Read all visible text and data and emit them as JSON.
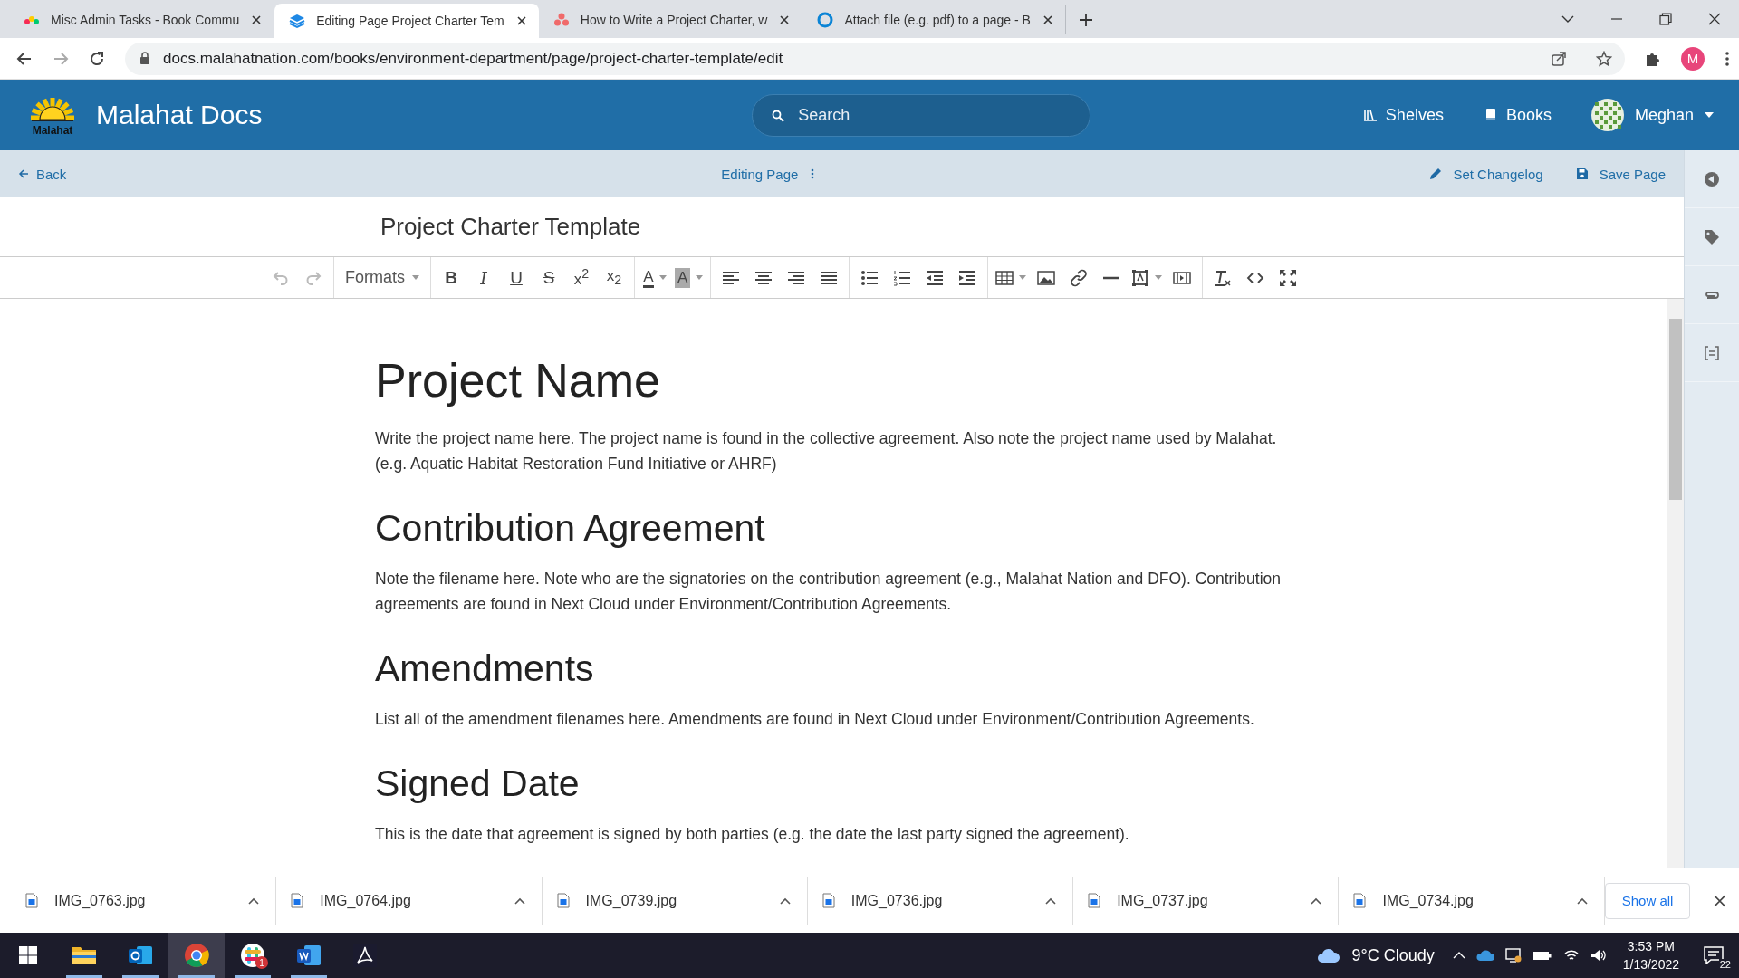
{
  "browser": {
    "tabs": [
      {
        "title": "Misc Admin Tasks - Book Commu",
        "kind": "dots",
        "selected": false
      },
      {
        "title": "Editing Page Project Charter Tem",
        "kind": "stack",
        "selected": true
      },
      {
        "title": "How to Write a Project Charter, w",
        "kind": "trio",
        "selected": false
      },
      {
        "title": "Attach file (e.g. pdf) to a page - B",
        "kind": "ring",
        "selected": false
      }
    ],
    "url": "docs.malahatnation.com/books/environment-department/page/project-charter-template/edit",
    "profile_initial": "M"
  },
  "header": {
    "logo_text": "Malahat",
    "site_name": "Malahat Docs",
    "search": {
      "placeholder": "Search"
    },
    "nav": [
      {
        "label": "Shelves",
        "kind": "shelves"
      },
      {
        "label": "Books",
        "kind": "books"
      }
    ],
    "user": "Meghan"
  },
  "editor_bar": {
    "back": "Back",
    "mode": "Editing Page",
    "actions": [
      {
        "label": "Set Changelog",
        "kind": "changelog"
      },
      {
        "label": "Save Page",
        "kind": "save"
      }
    ]
  },
  "page_title": "Project Charter Template",
  "toolbar": [
    [
      {
        "kind": "undo",
        "disabled": true
      },
      {
        "kind": "redo",
        "disabled": true
      }
    ],
    [
      {
        "kind": "formats",
        "label": "Formats",
        "menu": true
      }
    ],
    [
      {
        "kind": "bold",
        "label": "B"
      },
      {
        "kind": "italic",
        "label": "I"
      },
      {
        "kind": "underline",
        "label": "U"
      },
      {
        "kind": "strike",
        "label": "S"
      },
      {
        "kind": "script",
        "label": "x$^{2}$"
      },
      {
        "kind": "script",
        "label": "x$_{2}$"
      }
    ],
    [
      {
        "kind": "color",
        "label": "A",
        "menu": true
      },
      {
        "kind": "bgcolor",
        "label": "A",
        "menu": true
      }
    ],
    [
      {
        "kind": "align-left"
      },
      {
        "kind": "align-center"
      },
      {
        "kind": "align-right"
      },
      {
        "kind": "justify"
      }
    ],
    [
      {
        "kind": "bullets"
      },
      {
        "kind": "numbers"
      },
      {
        "kind": "outdent"
      },
      {
        "kind": "indent"
      }
    ],
    [
      {
        "kind": "table",
        "menu": true
      },
      {
        "kind": "image"
      },
      {
        "kind": "link"
      },
      {
        "kind": "rule"
      },
      {
        "kind": "frame",
        "menu": true
      },
      {
        "kind": "media"
      }
    ],
    [
      {
        "kind": "clear"
      },
      {
        "kind": "code"
      },
      {
        "kind": "fullscreen"
      }
    ]
  ],
  "content": [
    {
      "kind": "h1",
      "text": "Project Name"
    },
    {
      "kind": "p",
      "text": "Write the project name here. The project name is found in the collective agreement. Also note the project name used by Malahat. (e.g. Aquatic Habitat Restoration Fund Initiative or AHRF)"
    },
    {
      "kind": "h2",
      "text": "Contribution Agreement"
    },
    {
      "kind": "p",
      "text": "Note the filename here. Note who are the signatories on the contribution agreement (e.g., Malahat Nation and DFO). Contribution agreements are found in Next Cloud under Environment/Contribution Agreements."
    },
    {
      "kind": "h2",
      "text": "Amendments"
    },
    {
      "kind": "p",
      "text": "List all of the amendment filenames here. Amendments are found in Next Cloud under Environment/Contribution Agreements."
    },
    {
      "kind": "h2",
      "text": "Signed Date"
    },
    {
      "kind": "p",
      "text": "This is the date that agreement is signed by both parties (e.g. the date the last party signed the agreement)."
    }
  ],
  "downloads": {
    "files": [
      "IMG_0763.jpg",
      "IMG_0764.jpg",
      "IMG_0739.jpg",
      "IMG_0736.jpg",
      "IMG_0737.jpg",
      "IMG_0734.jpg"
    ],
    "show_all": "Show all"
  },
  "taskbar": {
    "apps": [
      {
        "kind": "folder",
        "open": true,
        "selected": false
      },
      {
        "kind": "mail",
        "open": true,
        "selected": false
      },
      {
        "kind": "browser",
        "open": true,
        "selected": true
      },
      {
        "kind": "chat",
        "open": true,
        "selected": false,
        "badge": "1"
      },
      {
        "kind": "word",
        "open": true,
        "selected": false
      },
      {
        "kind": "pdf",
        "open": false,
        "selected": false
      }
    ],
    "weather": "9°C Cloudy",
    "time": "3:53 PM",
    "date": "1/13/2022",
    "notifications": "22"
  }
}
